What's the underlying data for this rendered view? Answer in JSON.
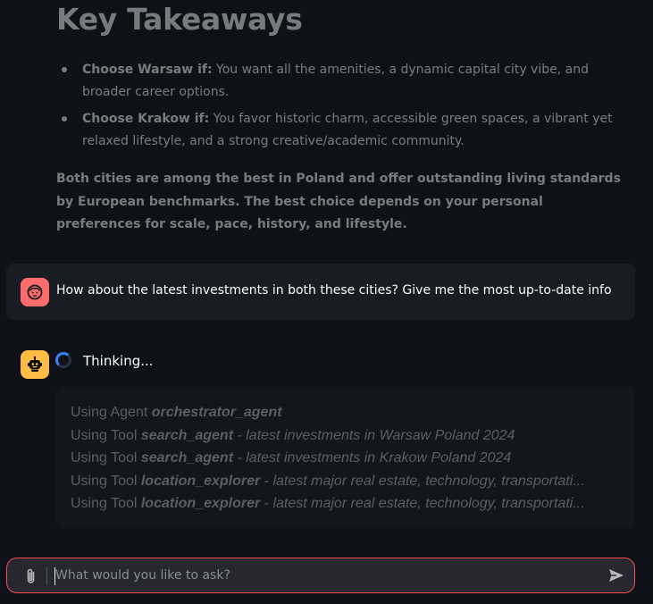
{
  "previous_answer": {
    "heading": "Key Takeaways",
    "bullets": [
      {
        "lead": "Choose Warsaw if:",
        "text": " You want all the amenities, a dynamic capital city vibe, and broader career options."
      },
      {
        "lead": "Choose Krakow if:",
        "text": " You favor historic charm, accessible green spaces, a vibrant yet relaxed lifestyle, and a strong creative/academic community."
      }
    ],
    "summary": "Both cities are among the best in Poland and offer outstanding living standards by European benchmarks. The best choice depends on your personal preferences for scale, pace, history, and lifestyle."
  },
  "user_message": {
    "text": "How about the latest investments in both these cities? Give me the most up-to-date info",
    "avatar_icon": "user-face-icon",
    "avatar_color": "#ff6c6c"
  },
  "assistant": {
    "avatar_icon": "robot-icon",
    "avatar_color": "#ffbd45",
    "status": "Thinking...",
    "steps": [
      {
        "prefix": "Using Agent ",
        "name": "orchestrator_agent",
        "detail": ""
      },
      {
        "prefix": "Using Tool ",
        "name": "search_agent",
        "detail": " - latest investments in Warsaw Poland 2024"
      },
      {
        "prefix": "Using Tool ",
        "name": "search_agent",
        "detail": " - latest investments in Krakow Poland 2024"
      },
      {
        "prefix": "Using Tool ",
        "name": "location_explorer",
        "detail": " - latest major real estate, technology, transportati..."
      },
      {
        "prefix": "Using Tool ",
        "name": "location_explorer",
        "detail": " - latest major real estate, technology, transportati..."
      }
    ]
  },
  "chat_input": {
    "placeholder": "What would you like to ask?",
    "value": "",
    "attach_icon": "paperclip-icon",
    "send_icon": "send-icon",
    "accent": "#ff4b4b"
  }
}
